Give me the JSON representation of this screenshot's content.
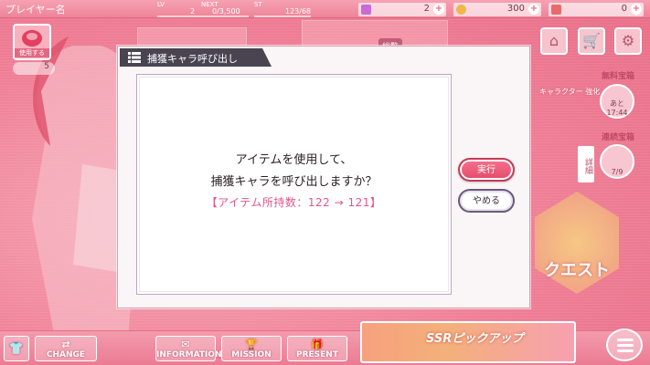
{
  "topbar": {
    "player_name": "プレイヤー名",
    "lv_label": "LV",
    "lv_value": "2",
    "next_label": "NEXT",
    "next_value": "0/3,500",
    "st_label": "ST",
    "st_value": "123/68",
    "gems": "2",
    "coins": "300",
    "tickets": "0"
  },
  "left": {
    "use_item_label": "使用する",
    "use_count": "5"
  },
  "right": {
    "free_chest_label": "無料宝箱",
    "free_chest_remaining": "あと",
    "free_chest_timer": "17:44",
    "streak_chest_label": "連続宝箱",
    "streak_chest_progress": "7/9",
    "detail_label": "詳細",
    "character_label": "キャラクター 強化",
    "quest_label": "クエスト",
    "summary_label": "総覧"
  },
  "dialog": {
    "title": "捕獲キャラ呼び出し",
    "line1": "アイテムを使用して、",
    "line2": "捕獲キャラを呼び出しますか？",
    "count_line": "【アイテム所持数：122 → 121】",
    "exec_label": "実行",
    "cancel_label": "やめる"
  },
  "bottombar": {
    "change": "CHANGE",
    "information": "INFORMATION",
    "mission": "MISSION",
    "present": "PRESENT",
    "banner_text": "SSRピックアップ"
  },
  "colors": {
    "accent": "#e24b6c",
    "count_text": "#e0568a",
    "header_bg": "#4a4450"
  }
}
